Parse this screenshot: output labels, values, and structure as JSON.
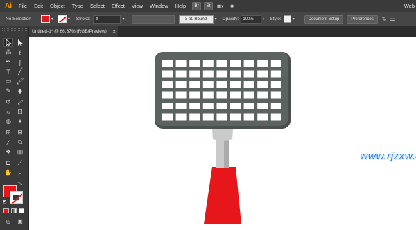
{
  "app": {
    "logo": "Ai"
  },
  "menu": {
    "items": [
      "File",
      "Edit",
      "Object",
      "Type",
      "Select",
      "Effect",
      "View",
      "Window",
      "Help"
    ],
    "icons": [
      "Br",
      "St"
    ],
    "right_text": "Web"
  },
  "control": {
    "selection_label": "No Selection",
    "stroke_label": "Stroke:",
    "brush_label": "3 pt. Round",
    "opacity_label": "Opacity:",
    "opacity_value": "100%",
    "style_label": "Style:",
    "document_setup": "Document Setup",
    "preferences": "Preferences",
    "fill_color": "#e6161b"
  },
  "document": {
    "tab_title": "Untitled-1* @ 66.67% (RGB/Preview)",
    "close_glyph": "✕"
  },
  "artwork": {
    "head_color": "#5c625f",
    "head_shadow": "#4a4f4c",
    "hole_color": "#ffffff",
    "stem_color": "#c9cbca",
    "stem_shade": "#a9acab",
    "handle_color": "#e6161b"
  },
  "watermark": {
    "text": "www.rjzxw.com",
    "color": "#2a84e6"
  },
  "colors": {
    "accent": "#e6161b",
    "chrome": "#3a3a3a"
  }
}
